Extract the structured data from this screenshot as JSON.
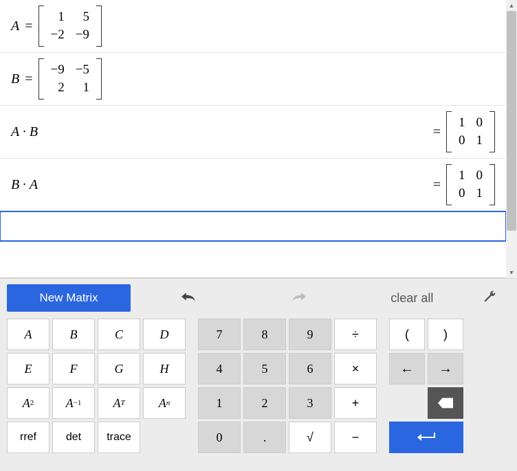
{
  "expressions": [
    {
      "lhsVar": "A",
      "lhsMatrix": [
        [
          "1",
          "5"
        ],
        [
          "−2",
          "−9"
        ]
      ],
      "result": null
    },
    {
      "lhsVar": "B",
      "lhsMatrix": [
        [
          "−9",
          "−5"
        ],
        [
          "2",
          "1"
        ]
      ],
      "result": null
    },
    {
      "lhsText": "A · B",
      "result": [
        [
          "1",
          "0"
        ],
        [
          "0",
          "1"
        ]
      ]
    },
    {
      "lhsText": "B · A",
      "result": [
        [
          "1",
          "0"
        ],
        [
          "0",
          "1"
        ]
      ]
    }
  ],
  "toolbar": {
    "newMatrix": "New Matrix",
    "clearAll": "clear all"
  },
  "keys": {
    "letters": [
      "A",
      "B",
      "C",
      "D",
      "E",
      "F",
      "G",
      "H"
    ],
    "powers": {
      "sq": "2",
      "inv": "−1",
      "trans": "T",
      "n": "n"
    },
    "funcs": [
      "rref",
      "det",
      "trace"
    ],
    "nums": [
      "7",
      "8",
      "9",
      "4",
      "5",
      "6",
      "1",
      "2",
      "3",
      "0",
      "."
    ],
    "ops": {
      "div": "÷",
      "mul": "×",
      "add": "+",
      "sub": "−",
      "sqrt": "√"
    },
    "parens": {
      "open": "(",
      "close": ")"
    },
    "nav": {
      "left": "←",
      "right": "→",
      "back": "⌫",
      "enter": "↵"
    }
  },
  "chart_data": {
    "type": "table",
    "definitions": {
      "A": [
        [
          1,
          5
        ],
        [
          -2,
          -9
        ]
      ],
      "B": [
        [
          -9,
          -5
        ],
        [
          2,
          1
        ]
      ]
    },
    "computations": [
      {
        "expression": "A · B",
        "result": [
          [
            1,
            0
          ],
          [
            0,
            1
          ]
        ]
      },
      {
        "expression": "B · A",
        "result": [
          [
            1,
            0
          ],
          [
            0,
            1
          ]
        ]
      }
    ]
  }
}
